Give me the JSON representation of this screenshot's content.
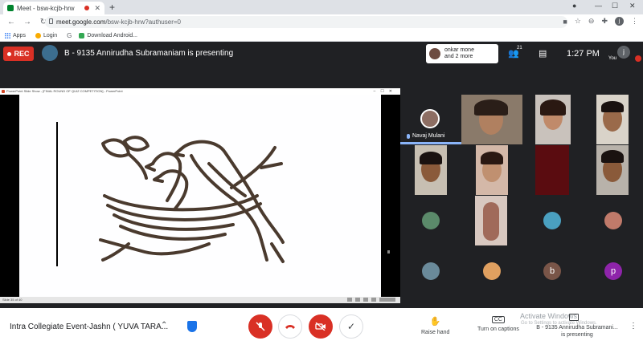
{
  "browser": {
    "tab_title": "Meet - bsw-kcjb-hrw",
    "tab_close": "✕",
    "new_tab": "+",
    "url_domain": "meet.google.com",
    "url_path": "/bsw-kcjb-hrw?authuser=0",
    "profile_letter": "j",
    "win_min": "—",
    "win_max": "☐",
    "win_close": "✕"
  },
  "bookmarks": [
    {
      "label": "Apps"
    },
    {
      "label": "Login"
    },
    {
      "label": "Download Android..."
    }
  ],
  "meet_header": {
    "rec_label": "REC",
    "presenting_text": "B - 9135 Annirudha Subramaniam is presenting",
    "others_line1": "onkar mone",
    "others_line2": "and 2 more",
    "people_count": "21",
    "time": "1:27 PM",
    "you_label": "You",
    "you_letter": "j"
  },
  "presentation": {
    "window_title": "PowerPoint Slide Show - [FINAL ROUND OF QUIZ COMPETITION] - PowerPoint",
    "status_text": "Slide 35 of 40"
  },
  "participants": {
    "pinned_name": "Navaj Mulani",
    "letter_b": "b",
    "letter_p": "p"
  },
  "bottom_bar": {
    "meeting_name": "Intra Collegiate Event-Jashn ( YUVA TARA...",
    "raise_hand_label": "Raise hand",
    "captions_label": "Turn on captions",
    "captions_icon": "CC",
    "activate_windows": "Activate Windows",
    "activate_sub": "Go to Settings to activate Windows.",
    "present_status_line1": "B - 9135 Annirudha Subramani...",
    "present_status_line2": "is presenting",
    "more_options": "⋮"
  },
  "colors": {
    "rec_red": "#d93025",
    "meet_dark": "#202124",
    "accent_blue": "#8ab4f8",
    "avatar_p": "#8e24aa",
    "avatar_b": "#795548"
  }
}
